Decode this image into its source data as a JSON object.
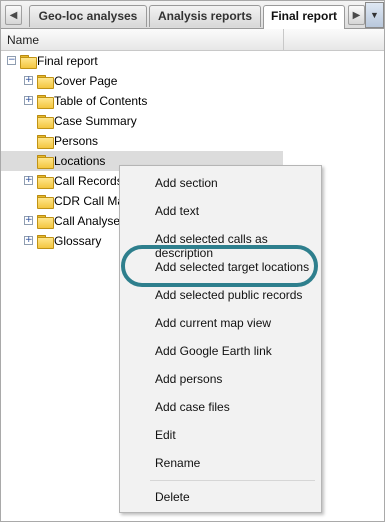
{
  "tabs": [
    {
      "label": "Geo-loc analyses",
      "active": false
    },
    {
      "label": "Analysis reports",
      "active": false
    },
    {
      "label": "Final report",
      "active": true
    }
  ],
  "tab_scroll_left_icon": "arrow-left-icon",
  "tab_scroll_right_icon": "arrow-right-icon",
  "tab_menu_icon": "chevron-down-icon",
  "column_header": {
    "name": "Name"
  },
  "tree": {
    "root": "Final report",
    "items": [
      {
        "label": "Cover Page",
        "expandable": true
      },
      {
        "label": "Table of Contents",
        "expandable": true
      },
      {
        "label": "Case Summary",
        "expandable": false
      },
      {
        "label": "Persons",
        "expandable": false
      },
      {
        "label": "Locations",
        "expandable": false,
        "selected": true
      },
      {
        "label": "Call Records",
        "expandable": true
      },
      {
        "label": "CDR Call Map",
        "expandable": false
      },
      {
        "label": "Call Analyses",
        "expandable": true
      },
      {
        "label": "Glossary",
        "expandable": true
      }
    ]
  },
  "context_menu": {
    "items": [
      "Add section",
      "Add text",
      "Add selected calls as description",
      "Add selected target locations",
      "Add selected public records",
      "Add current map view",
      "Add Google Earth link",
      "Add persons",
      "Add case files",
      "Edit",
      "Rename",
      "Delete"
    ],
    "highlighted_item": "Add selected target locations"
  },
  "colors": {
    "highlight_ring": "#2e7f8d",
    "selected_row": "#dcdcdc",
    "menu_bg": "#f2f2f2"
  }
}
